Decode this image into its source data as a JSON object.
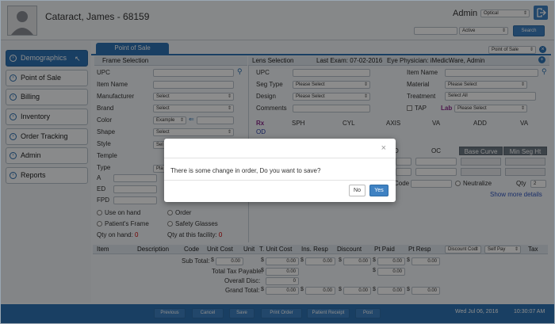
{
  "patient": {
    "name": "Cataract, James - 68159"
  },
  "topbar": {
    "user": "Admin",
    "location": "Optical",
    "status": "Active",
    "search_label": "Search"
  },
  "nav": [
    {
      "label": "Demographics",
      "active": true
    },
    {
      "label": "Point of Sale"
    },
    {
      "label": "Billing"
    },
    {
      "label": "Inventory"
    },
    {
      "label": "Order Tracking"
    },
    {
      "label": "Admin"
    },
    {
      "label": "Reports"
    }
  ],
  "tab": {
    "label": "Point of Sale",
    "dropdown": "Point of Sale"
  },
  "frame": {
    "header": "Frame Selection",
    "upc": "UPC",
    "item_name": "Item Name",
    "manufacturer": "Manufacturer",
    "brand": "Brand",
    "color": "Color",
    "shape": "Shape",
    "style": "Style",
    "temple": "Temple",
    "type": "Type",
    "a": "A",
    "ed": "ED",
    "fpd": "FPD",
    "manufacturer_val": "Select",
    "brand_val": "Select",
    "color_val": "Example",
    "shape_val": "Select",
    "style_val": "Sel",
    "type_val": "Pla",
    "use_on_hand": "Use on hand",
    "order": "Order",
    "patients_frame": "Patient's Frame",
    "safety_glasses": "Safety Glasses",
    "qty_on_hand": "Qty on hand:",
    "qty_on_hand_val": "0",
    "qty_facility": "Qty at this facility:",
    "qty_facility_val": "0"
  },
  "lens": {
    "header": "Lens Selection",
    "last_exam": "Last Exam: 07-02-2016",
    "physician": "Eye Physician: iMedicWare, Admin",
    "upc": "UPC",
    "seg_type": "Seg Type",
    "design": "Design",
    "comments": "Comments",
    "seg_val": "Please Select",
    "design_val": "Please Select",
    "item_name": "Item Name",
    "material": "Material",
    "treatment": "Treatment",
    "material_val": "Please Select",
    "treatment_val": "Select All",
    "tap": "TAP",
    "lab": "Lab",
    "lab_val": "Please Select",
    "rx": "Rx",
    "od": "OD",
    "cols": [
      "SPH",
      "CYL",
      "AXIS",
      "VA",
      "ADD",
      "VA"
    ],
    "d": "D",
    "oc": "OC",
    "base_curve": "Base Curve",
    "min_seg": "Min Seg Ht",
    "code": "Code",
    "neutralize": "Neutralize",
    "qty": "Qty",
    "qty_val": "2",
    "show_more": "Show more details"
  },
  "table": {
    "cols": [
      "Item",
      "Description",
      "Code",
      "Unit Cost",
      "Unit",
      "T. Unit Cost",
      "Ins. Resp",
      "Discount",
      "Pt Paid",
      "Pt Resp"
    ],
    "discount_code": "Discount Cod",
    "self_pay": "Self Pay",
    "tax": "Tax",
    "sub_total": "Sub Total:",
    "tax_payable": "Total Tax Payable:",
    "overall_disc": "Overall Disc:",
    "grand_total": "Grand Total:",
    "zero": "0.00",
    "disc_zero": "0"
  },
  "footer": {
    "buttons": [
      "Previous",
      "Cancel",
      "Save",
      "Print Order",
      "Patient Receipt",
      "Post"
    ],
    "date": "Wed Jul 06, 2016",
    "time": "10:30:07 AM"
  },
  "dialog": {
    "message": "There is some change in order, Do you want to save?",
    "no": "No",
    "yes": "Yes",
    "close": "×"
  }
}
